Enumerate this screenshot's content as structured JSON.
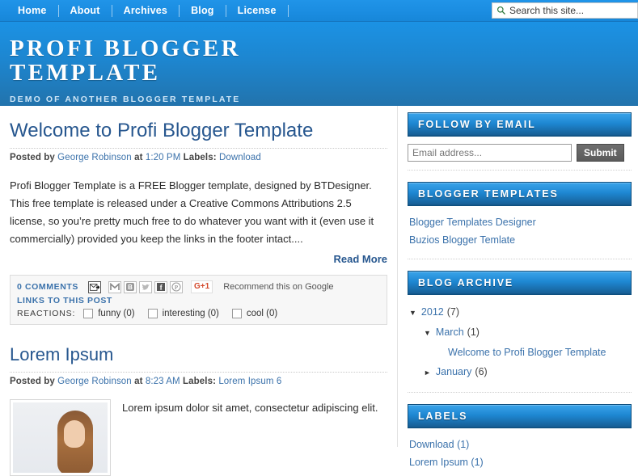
{
  "nav": {
    "items": [
      {
        "label": "Home"
      },
      {
        "label": "About"
      },
      {
        "label": "Archives"
      },
      {
        "label": "Blog"
      },
      {
        "label": "License"
      }
    ]
  },
  "search": {
    "placeholder": "Search this site...",
    "value": "",
    "icon": "search-icon"
  },
  "banner": {
    "title": "PROFI BLOGGER TEMPLATE",
    "subtitle": "DEMO OF ANOTHER BLOGGER TEMPLATE",
    "gradient_top": "#1b92e4",
    "gradient_bottom": "#2273ac"
  },
  "colors": {
    "nav_blue": "#1b8de1",
    "link_blue": "#3b72ab",
    "heading_blue": "#27578f",
    "widget_head_top": "#3aa4ea",
    "widget_head_bottom": "#0f4f80",
    "gplus_red": "#d3492c"
  },
  "posts": [
    {
      "title": "Welcome to Profi Blogger Template",
      "meta": {
        "posted_by_label": "Posted by",
        "author": "George Robinson",
        "at_label": "at",
        "time": "1:20 PM",
        "labels_label": "Labels:",
        "labels": "Download"
      },
      "body": "Profi Blogger Template is a FREE Blogger template, designed by BTDesigner. This free template is released under a Creative Commons Attributions 2.5 license, so you’re pretty much free to do whatever you want with it (even use it commercially) provided you keep the links in the footer intact....",
      "read_more": "Read More",
      "footer": {
        "comments": "0 COMMENTS",
        "share_icons": [
          "email-post-icon",
          "gmail-icon",
          "blogger-icon",
          "twitter-icon",
          "facebook-icon",
          "pinterest-icon"
        ],
        "gplus_label": "G+1",
        "recommend_text": "Recommend this on Google",
        "links_to_post": "LINKS TO THIS POST",
        "reactions_label": "REACTIONS:",
        "reactions": [
          {
            "label": "funny (0)",
            "checked": false
          },
          {
            "label": "interesting (0)",
            "checked": false
          },
          {
            "label": "cool (0)",
            "checked": false
          }
        ]
      }
    },
    {
      "title": "Lorem Ipsum",
      "meta": {
        "posted_by_label": "Posted by",
        "author": "George Robinson",
        "at_label": "at",
        "time": "8:23 AM",
        "labels_label": "Labels:",
        "labels": "Lorem Ipsum 6"
      },
      "body": "Lorem ipsum dolor sit amet, consectetur adipiscing elit.",
      "thumb_alt": "woman-portrait-thumbnail"
    }
  ],
  "sidebar": {
    "widgets": [
      {
        "id": "follow-by-email",
        "title": "FOLLOW BY EMAIL",
        "email_placeholder": "Email address...",
        "email_value": "",
        "submit_label": "Submit"
      },
      {
        "id": "blogger-templates",
        "title": "BLOGGER TEMPLATES",
        "links": [
          "Blogger Templates Designer",
          "Buzios Blogger Temlate"
        ]
      },
      {
        "id": "blog-archive",
        "title": "BLOG ARCHIVE",
        "archive": [
          {
            "level": "year",
            "arrow": "▼",
            "expanded": true,
            "label": "2012",
            "count": "(7)"
          },
          {
            "level": "month",
            "arrow": "▼",
            "expanded": true,
            "label": "March",
            "count": "(1)"
          },
          {
            "level": "post",
            "arrow": "",
            "expanded": null,
            "label": "Welcome to Profi Blogger Template",
            "count": ""
          },
          {
            "level": "month",
            "arrow": "►",
            "expanded": false,
            "label": "January",
            "count": "(6)"
          }
        ]
      },
      {
        "id": "labels",
        "title": "LABELS",
        "links": [
          "Download (1)",
          "Lorem Ipsum (1)"
        ]
      }
    ]
  }
}
